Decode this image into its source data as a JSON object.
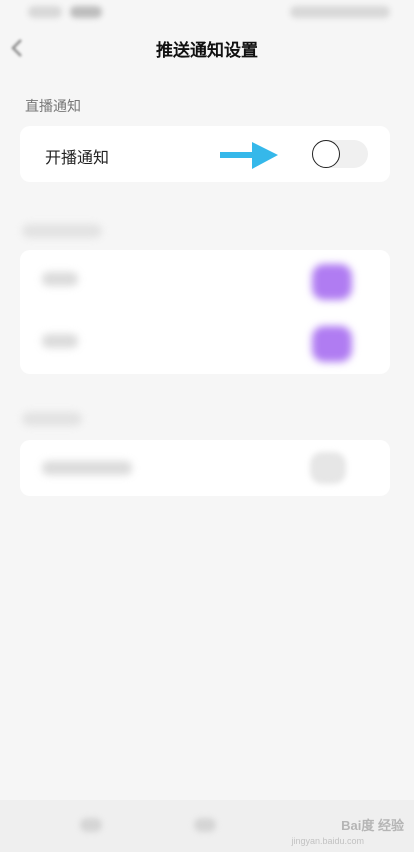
{
  "header": {
    "title": "推送通知设置"
  },
  "live_section": {
    "label": "直播通知",
    "row_label": "开播通知",
    "toggle_on": false
  },
  "blurred_sections": {
    "section_a_label": "",
    "rows": [
      "",
      ""
    ],
    "section_b_label": "",
    "row_b": ""
  },
  "watermark": {
    "brand": "Bai度 经验",
    "url": "jingyan.baidu.com"
  },
  "colors": {
    "accent_arrow": "#35b8ea",
    "blurred_toggle": "#b07cf2"
  }
}
